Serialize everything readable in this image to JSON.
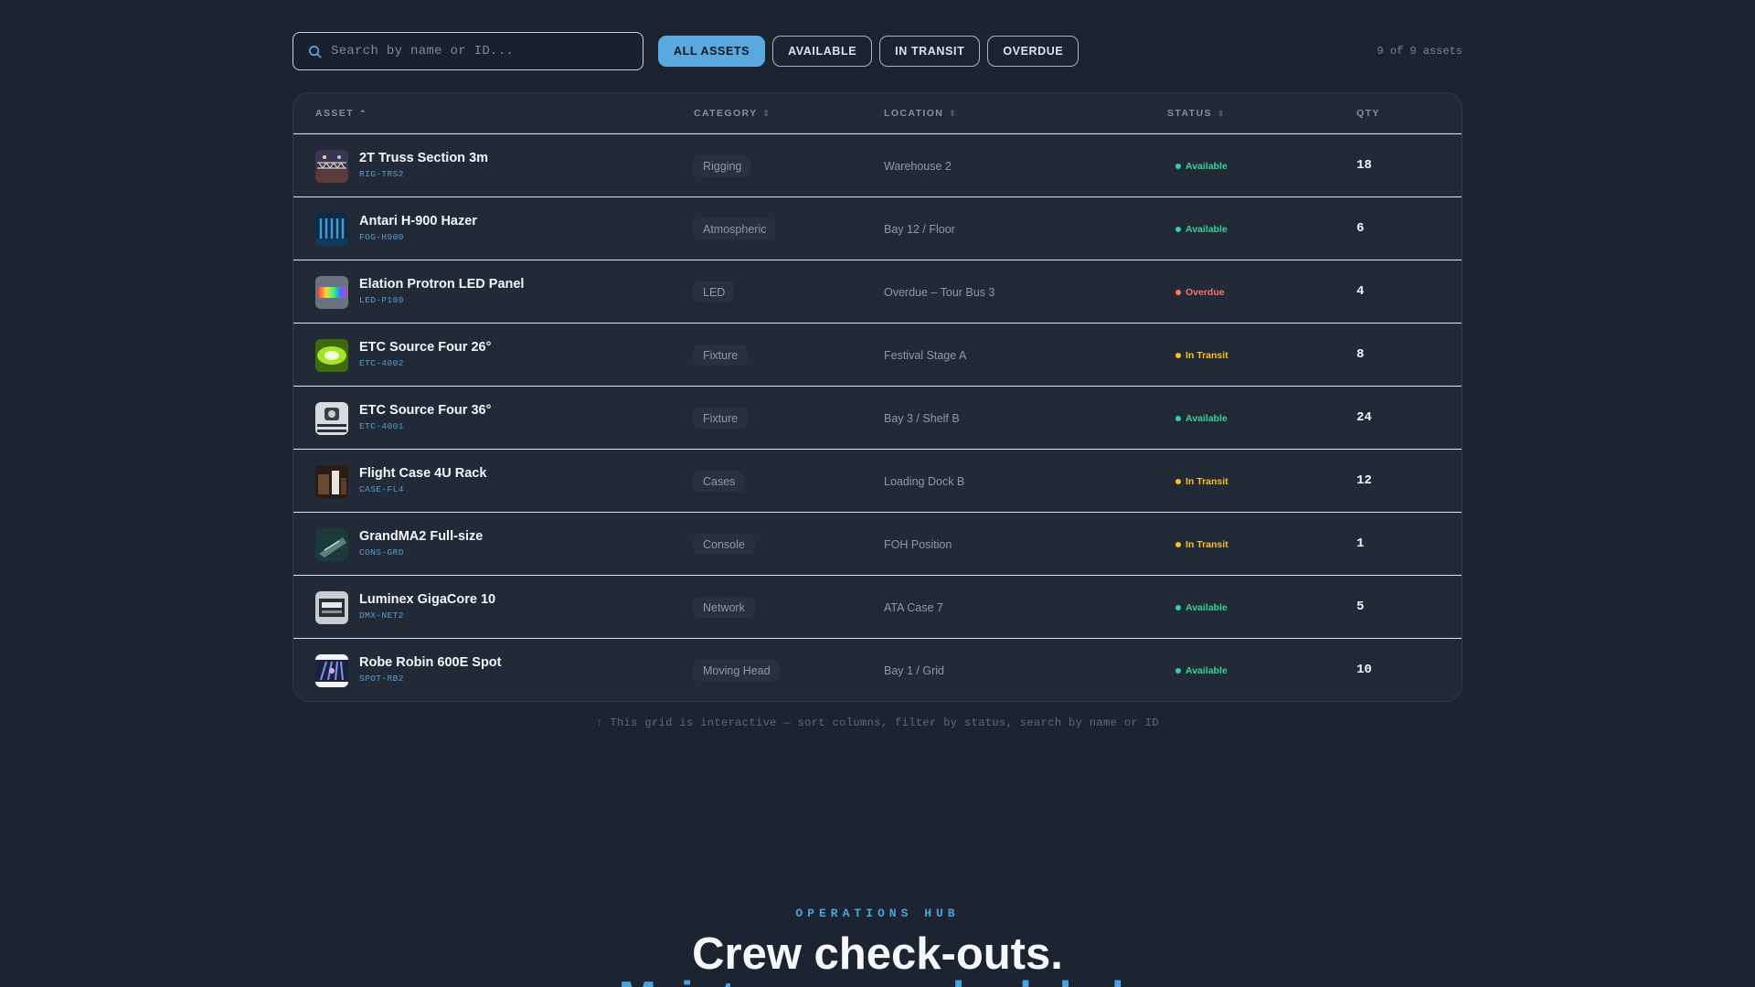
{
  "search": {
    "placeholder": "Search by name or ID..."
  },
  "filters": [
    {
      "label": "ALL ASSETS",
      "active": true
    },
    {
      "label": "AVAILABLE",
      "active": false
    },
    {
      "label": "IN TRANSIT",
      "active": false
    },
    {
      "label": "OVERDUE",
      "active": false
    }
  ],
  "result_count": "9 of 9 assets",
  "columns": {
    "asset": "ASSET",
    "category": "CATEGORY",
    "location": "LOCATION",
    "status": "STATUS",
    "qty": "QTY"
  },
  "rows": [
    {
      "name": "2T Truss Section 3m",
      "id": "RIG-TRS2",
      "category": "Rigging",
      "location": "Warehouse 2",
      "status": "Available",
      "qty": "18"
    },
    {
      "name": "Antari H-900 Hazer",
      "id": "FOG-H900",
      "category": "Atmospheric",
      "location": "Bay 12 / Floor",
      "status": "Available",
      "qty": "6"
    },
    {
      "name": "Elation Protron LED Panel",
      "id": "LED-P100",
      "category": "LED",
      "location": "Overdue – Tour Bus 3",
      "status": "Overdue",
      "qty": "4"
    },
    {
      "name": "ETC Source Four 26°",
      "id": "ETC-4002",
      "category": "Fixture",
      "location": "Festival Stage A",
      "status": "In Transit",
      "qty": "8"
    },
    {
      "name": "ETC Source Four 36°",
      "id": "ETC-4001",
      "category": "Fixture",
      "location": "Bay 3 / Shelf B",
      "status": "Available",
      "qty": "24"
    },
    {
      "name": "Flight Case 4U Rack",
      "id": "CASE-FL4",
      "category": "Cases",
      "location": "Loading Dock B",
      "status": "In Transit",
      "qty": "12"
    },
    {
      "name": "GrandMA2 Full-size",
      "id": "CONS-GRD",
      "category": "Console",
      "location": "FOH Position",
      "status": "In Transit",
      "qty": "1"
    },
    {
      "name": "Luminex GigaCore 10",
      "id": "DMX-NET2",
      "category": "Network",
      "location": "ATA Case 7",
      "status": "Available",
      "qty": "5"
    },
    {
      "name": "Robe Robin 600E Spot",
      "id": "SPOT-RB2",
      "category": "Moving Head",
      "location": "Bay 1 / Grid",
      "status": "Available",
      "qty": "10"
    }
  ],
  "hint": "↑ This grid is interactive — sort columns, filter by status, search by name or ID",
  "section": {
    "eyebrow": "OPERATIONS HUB",
    "headline": "Crew check-outs.",
    "headline2": "Maintenance scheduled."
  },
  "colors": {
    "accent": "#5aa8e0",
    "available": "#34d399",
    "in_transit": "#fbbf24",
    "overdue": "#f87171"
  }
}
